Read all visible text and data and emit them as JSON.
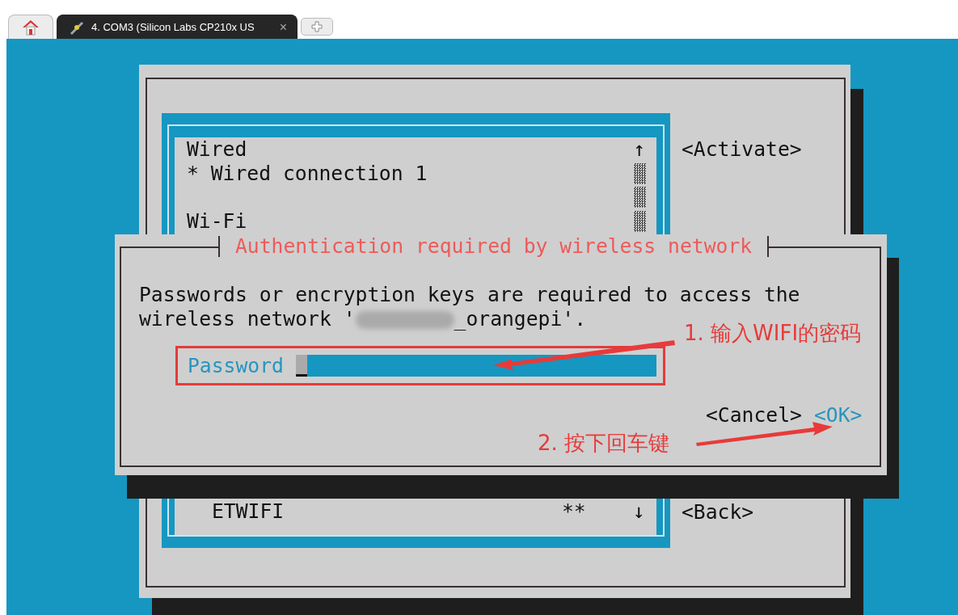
{
  "tabs": [
    {
      "kind": "home",
      "selected": false
    },
    {
      "kind": "session",
      "label": "4. COM3  (Silicon Labs CP210x US",
      "close": "×",
      "selected": true
    },
    {
      "kind": "new",
      "selected": false
    }
  ],
  "terminal": {
    "list": {
      "scroll_up": "↑",
      "scroll_down": "↓",
      "items": [
        {
          "text": "Wired",
          "blank_line_before": false
        },
        {
          "text": "* Wired connection 1",
          "blank_line_before": false
        },
        {
          "text": "Wi-Fi",
          "blank_line_before": true
        }
      ],
      "bottom_item": {
        "name": "ETWIFI",
        "signal": "**"
      }
    },
    "buttons": [
      {
        "label": "<Activate>"
      },
      {
        "label": "<Back>"
      }
    ]
  },
  "dialog": {
    "title": "Authentication required by wireless network",
    "message_line1": "Passwords or encryption keys are required to access the",
    "message_line2_start": "wireless network '",
    "message_line2_end": "_orangepi'.",
    "password_label": "Password",
    "buttons": [
      {
        "label": "<Cancel>",
        "selected": false
      },
      {
        "label": "<OK>",
        "selected": true
      }
    ]
  },
  "annotations": [
    {
      "text": "1. 输入WIFI的密码"
    },
    {
      "text": "2. 按下回车键"
    }
  ]
}
